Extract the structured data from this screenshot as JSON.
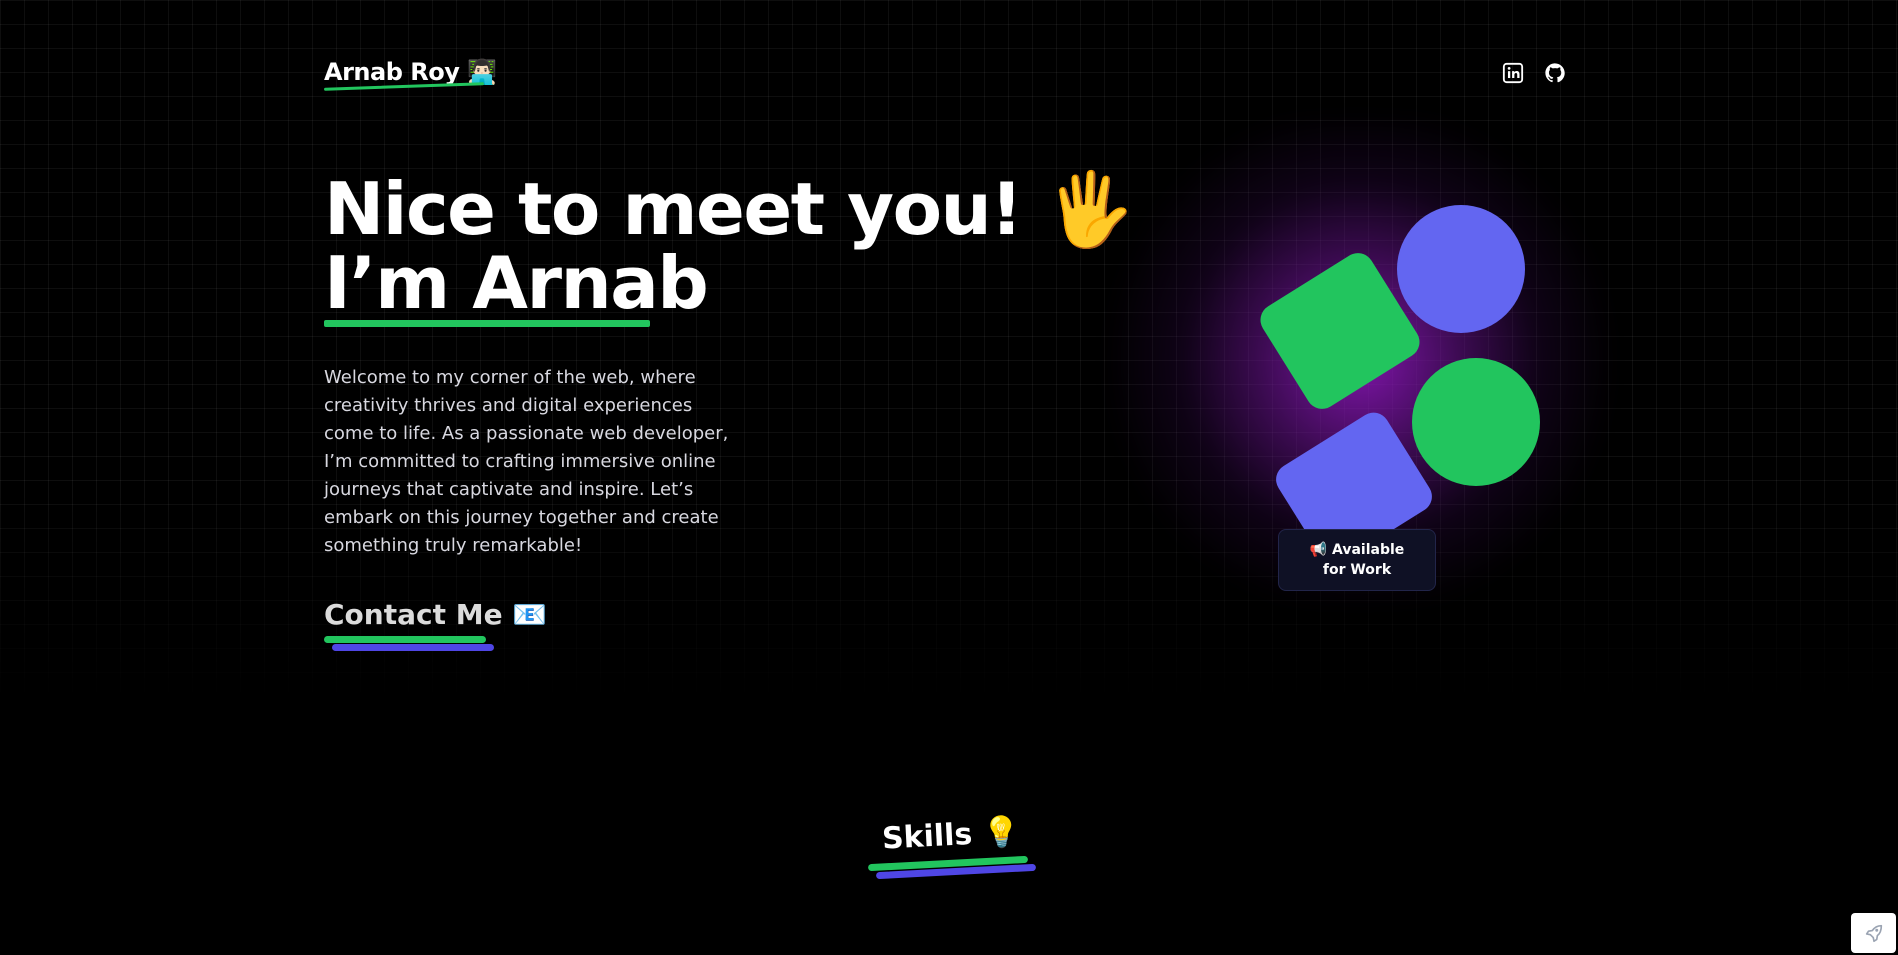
{
  "header": {
    "logo_text": "Arnab Roy 👨🏻‍💻",
    "social_links": [
      {
        "icon": "linkedin-icon",
        "label": "LinkedIn"
      },
      {
        "icon": "github-icon",
        "label": "GitHub"
      }
    ]
  },
  "hero": {
    "title_line1": "Nice to meet you! 🖐️",
    "title_line2": "I’m Arnab",
    "intro": "Welcome to my corner of the web, where creativity thrives and digital experiences come to life. As a passionate web developer, I’m committed to crafting immersive online journeys that captivate and inspire. Let’s embark on this journey together and create something truly remarkable!",
    "contact_label": "Contact Me 📧",
    "availability_badge": "📢 Available for Work"
  },
  "skills": {
    "heading": "Skills 💡"
  },
  "colors": {
    "background": "#000000",
    "accent_green": "#22c55e",
    "accent_indigo": "#6366f1",
    "glow_purple": "#9619c8",
    "badge_bg": "#0f1125"
  },
  "floating_button": {
    "icon": "rocket-icon"
  }
}
